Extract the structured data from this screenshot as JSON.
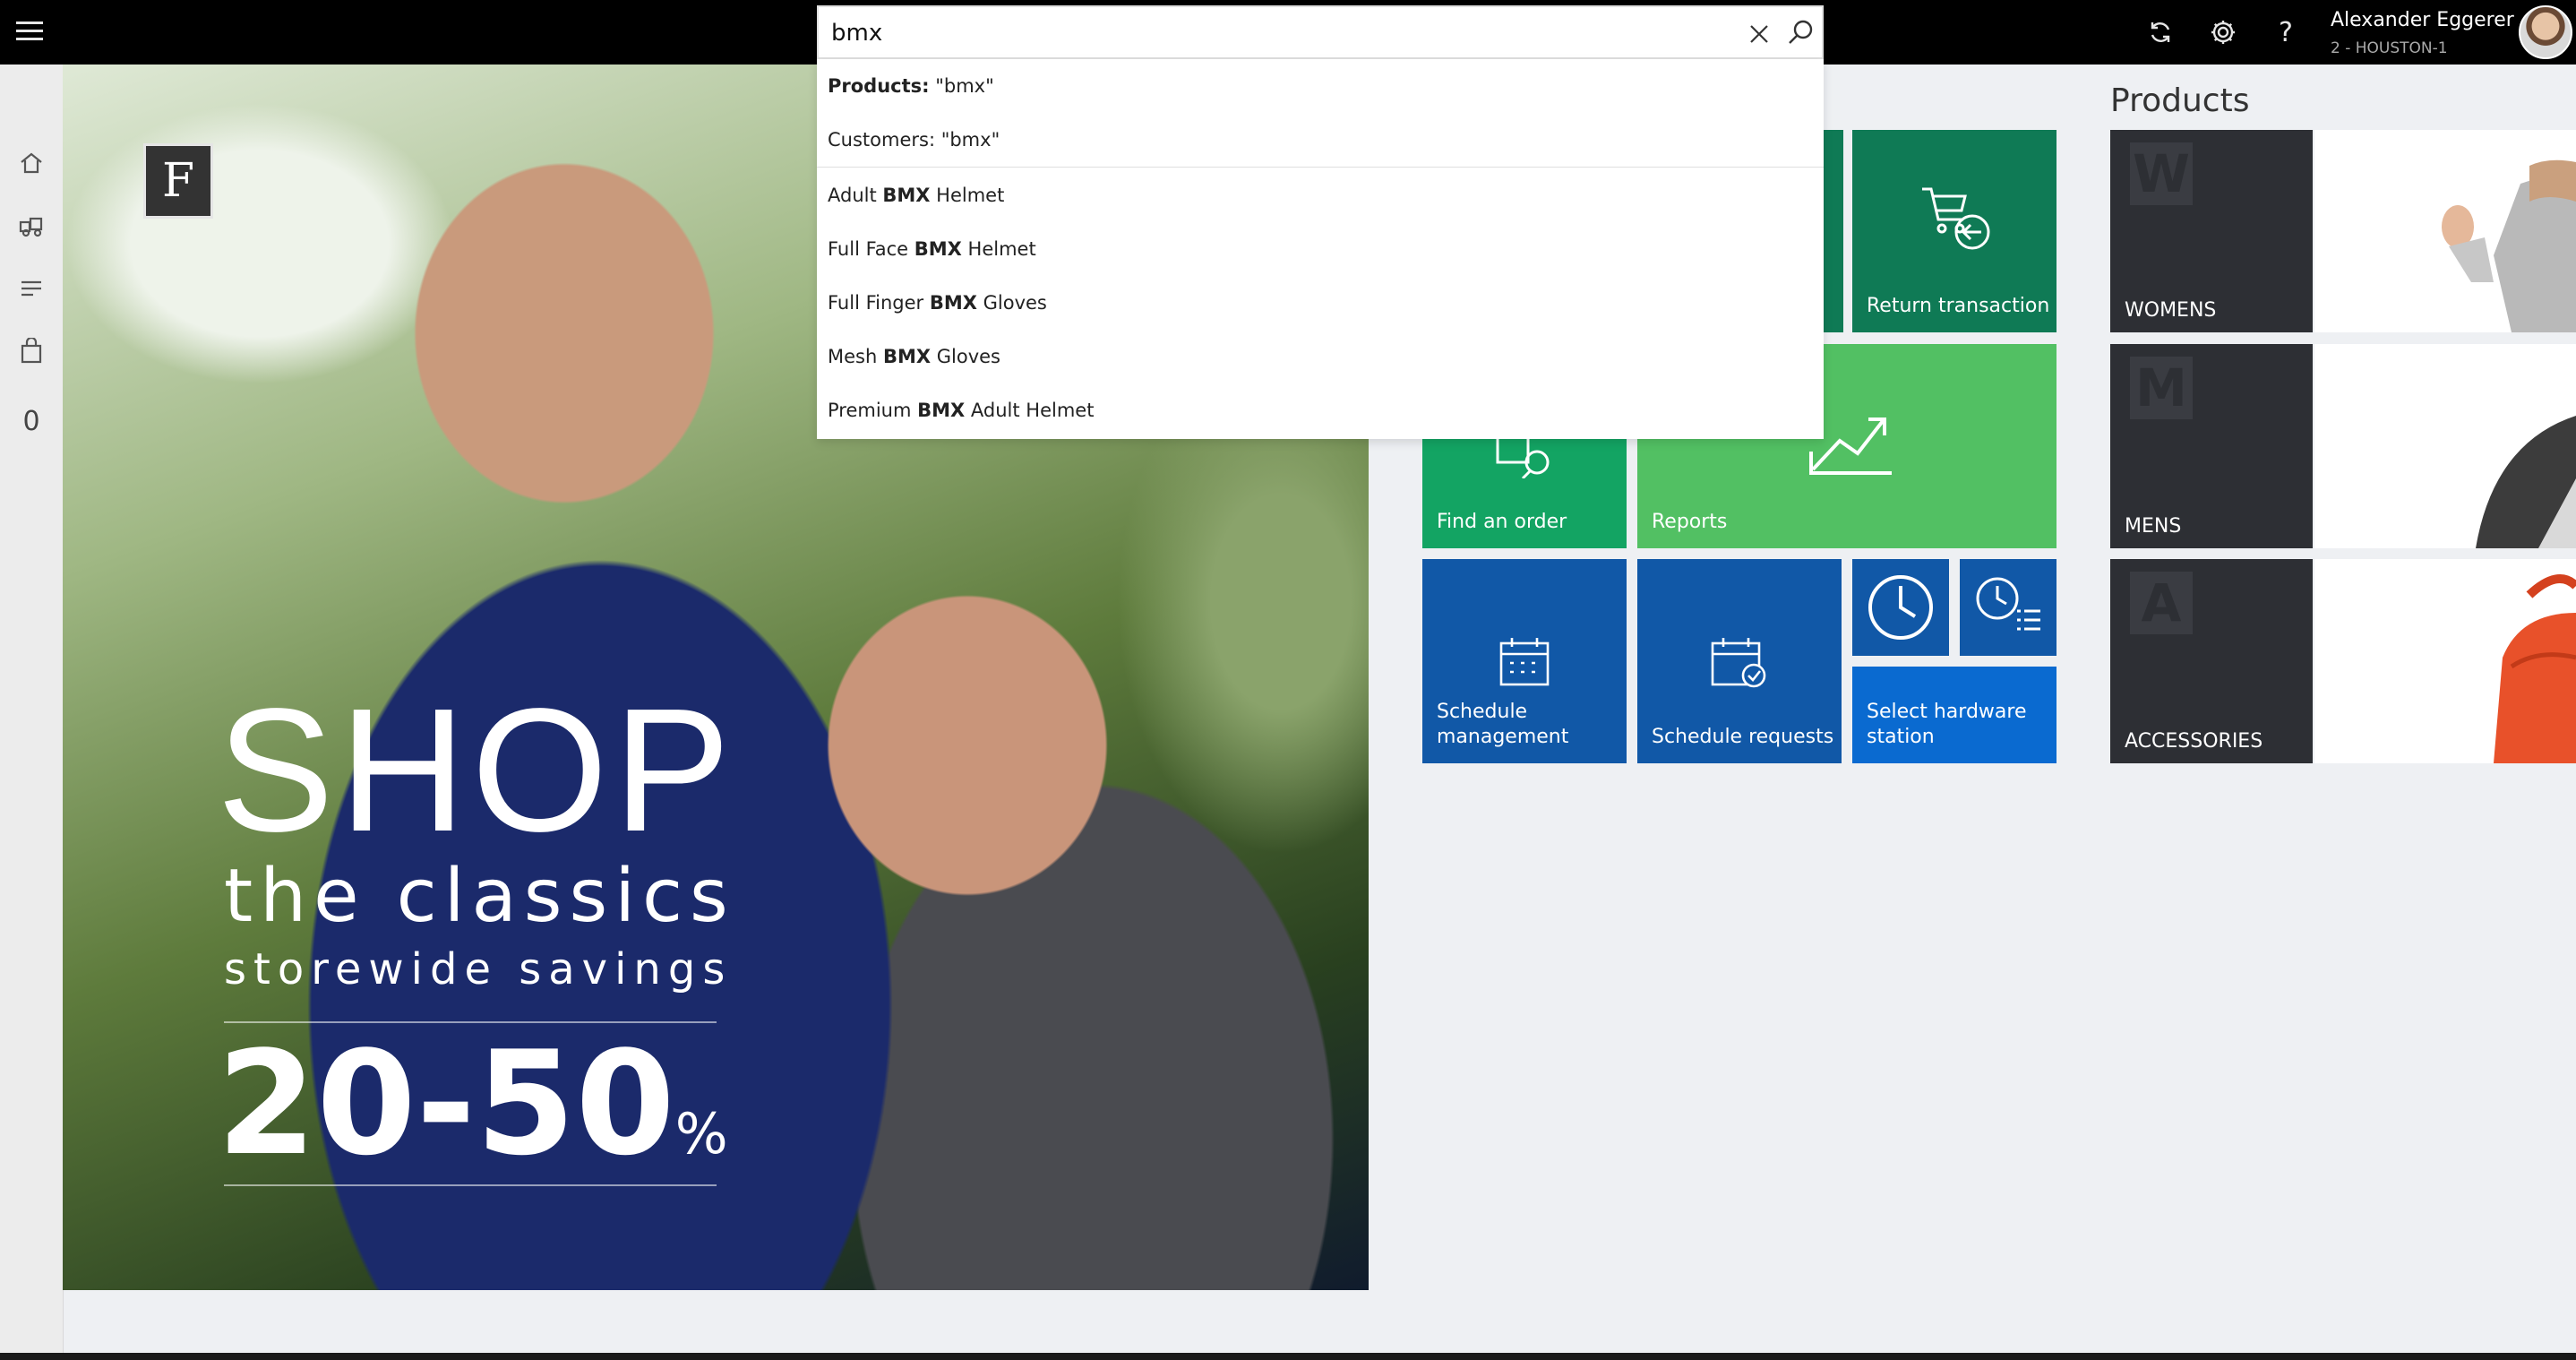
{
  "topbar": {
    "user_name": "Alexander Eggerer",
    "user_store": "2 - HOUSTON-1",
    "icons": [
      "menu-icon",
      "refresh-icon",
      "settings-icon",
      "help-icon"
    ]
  },
  "search": {
    "query": "bmx",
    "dropdown": {
      "scoped": [
        {
          "label": "Products:",
          "value": " \"bmx\""
        },
        {
          "label": "Customers: \"bmx\""
        }
      ],
      "suggestions": [
        {
          "pre": "Adult ",
          "match": "BMX",
          "post": " Helmet"
        },
        {
          "pre": "Full Face ",
          "match": "BMX",
          "post": " Helmet"
        },
        {
          "pre": "Full Finger ",
          "match": "BMX",
          "post": " Gloves"
        },
        {
          "pre": "Mesh ",
          "match": "BMX",
          "post": " Gloves"
        },
        {
          "pre": "Premium ",
          "match": "BMX",
          "post": " Adult Helmet"
        }
      ]
    }
  },
  "leftrail": {
    "cart_count": "0",
    "icons": [
      "home-icon",
      "products-icon",
      "transactions-icon",
      "bag-icon"
    ]
  },
  "hero": {
    "logo_letter": "F",
    "headline": "SHOP",
    "subline1": "the classics",
    "subline2": "storewide  savings",
    "discount": "20-50",
    "discount_sign": "%"
  },
  "tiles": {
    "return_transaction": "Return transaction",
    "find_order": "Find an order",
    "reports": "Reports",
    "schedule_management": "Schedule management",
    "schedule_requests": "Schedule requests",
    "select_hardware": "Select hardware station"
  },
  "products": {
    "title": "Products",
    "categories": [
      {
        "name": "WOMENS",
        "letter": "W"
      },
      {
        "name": "MENS",
        "letter": "M"
      },
      {
        "name": "ACCESSORIES",
        "letter": "A"
      }
    ]
  },
  "colors": {
    "dark_green": "#0f7a55",
    "green": "#13a463",
    "light_green": "#52c063",
    "blue": "#1158a7",
    "bright_blue": "#0a6ad0",
    "topbar": "#000000"
  }
}
